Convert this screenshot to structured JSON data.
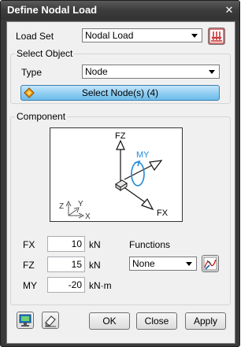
{
  "window": {
    "title": "Define Nodal Load",
    "close_glyph": "✕"
  },
  "load_set": {
    "label": "Load Set",
    "value": "Nodal Load"
  },
  "select_object": {
    "group_title": "Select Object",
    "type_label": "Type",
    "type_value": "Node",
    "select_button": "Select Node(s) (4)"
  },
  "component": {
    "group_title": "Component",
    "diagram": {
      "fz": "FZ",
      "my": "MY",
      "fx": "FX",
      "axis_z": "Z",
      "axis_y": "Y",
      "axis_x": "X"
    },
    "fx": {
      "label": "FX",
      "value": "10",
      "unit": "kN"
    },
    "fz": {
      "label": "FZ",
      "value": "15",
      "unit": "kN"
    },
    "my": {
      "label": "MY",
      "value": "-20",
      "unit": "kN·m"
    },
    "functions_label": "Functions",
    "functions_value": "None"
  },
  "buttons": {
    "ok": "OK",
    "close": "Close",
    "apply": "Apply"
  },
  "colors": {
    "accent_blue": "#1e8ad6",
    "select_button": "#8fcdf2",
    "titlebar": "#3c3c3c"
  }
}
